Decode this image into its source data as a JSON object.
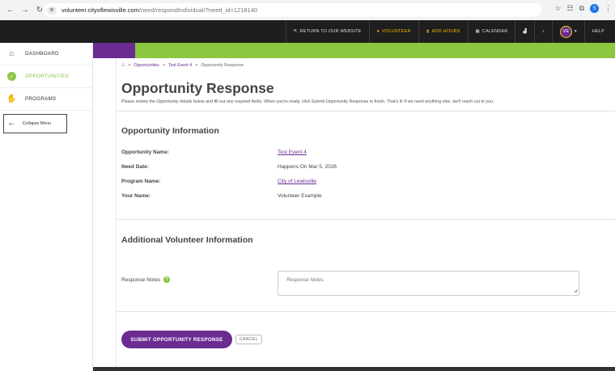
{
  "browser": {
    "url_host": "volunteer.cityoflewisville.com",
    "url_path": "/need/respondIndividual/?need_id=1218140",
    "profile_initial": "S"
  },
  "topnav": {
    "return_label": "RETURN TO OUR WEBSITE",
    "volunteer_label": "VOLUNTEER",
    "add_hours_label": "ADD HOURS",
    "calendar_label": "CALENDAR",
    "user_initials": "VE",
    "help_label": "HELP"
  },
  "sidebar": {
    "items": [
      {
        "label": "DASHBOARD",
        "icon": "house-icon"
      },
      {
        "label": "OPPORTUNITIES",
        "icon": "check-circle-icon"
      },
      {
        "label": "PROGRAMS",
        "icon": "hands-icon"
      }
    ],
    "collapse_label": "Collapse Menu"
  },
  "breadcrumb": {
    "items": [
      "Opportunities",
      "Test Event 4",
      "Opportunity Response"
    ]
  },
  "page": {
    "title": "Opportunity Response",
    "description": "Please review the Opportunity details below and fill out any required fields. When you're ready, click Submit Opportunity Response to finish. That's it! If we need anything else, we'll reach out to you."
  },
  "opportunity_info": {
    "heading": "Opportunity Information",
    "rows": [
      {
        "label": "Opportunity Name:",
        "value": "Test Event 4"
      },
      {
        "label": "Need Date:",
        "value": "Happens On Mar 5, 2026"
      },
      {
        "label": "Program Name:",
        "value": "City of Lewisville"
      },
      {
        "label": "Your Name:",
        "value": "Volunteer Example"
      }
    ]
  },
  "additional_info": {
    "heading": "Additional Volunteer Information",
    "notes_label": "Response Notes",
    "notes_placeholder": "Response Notes"
  },
  "actions": {
    "submit_label": "SUBMIT OPPORTUNITY RESPONSE",
    "cancel_label": "CANCEL"
  },
  "colors": {
    "brand_purple": "#6a2c91",
    "brand_green": "#8dc63f",
    "accent_gold": "#f5b800"
  }
}
